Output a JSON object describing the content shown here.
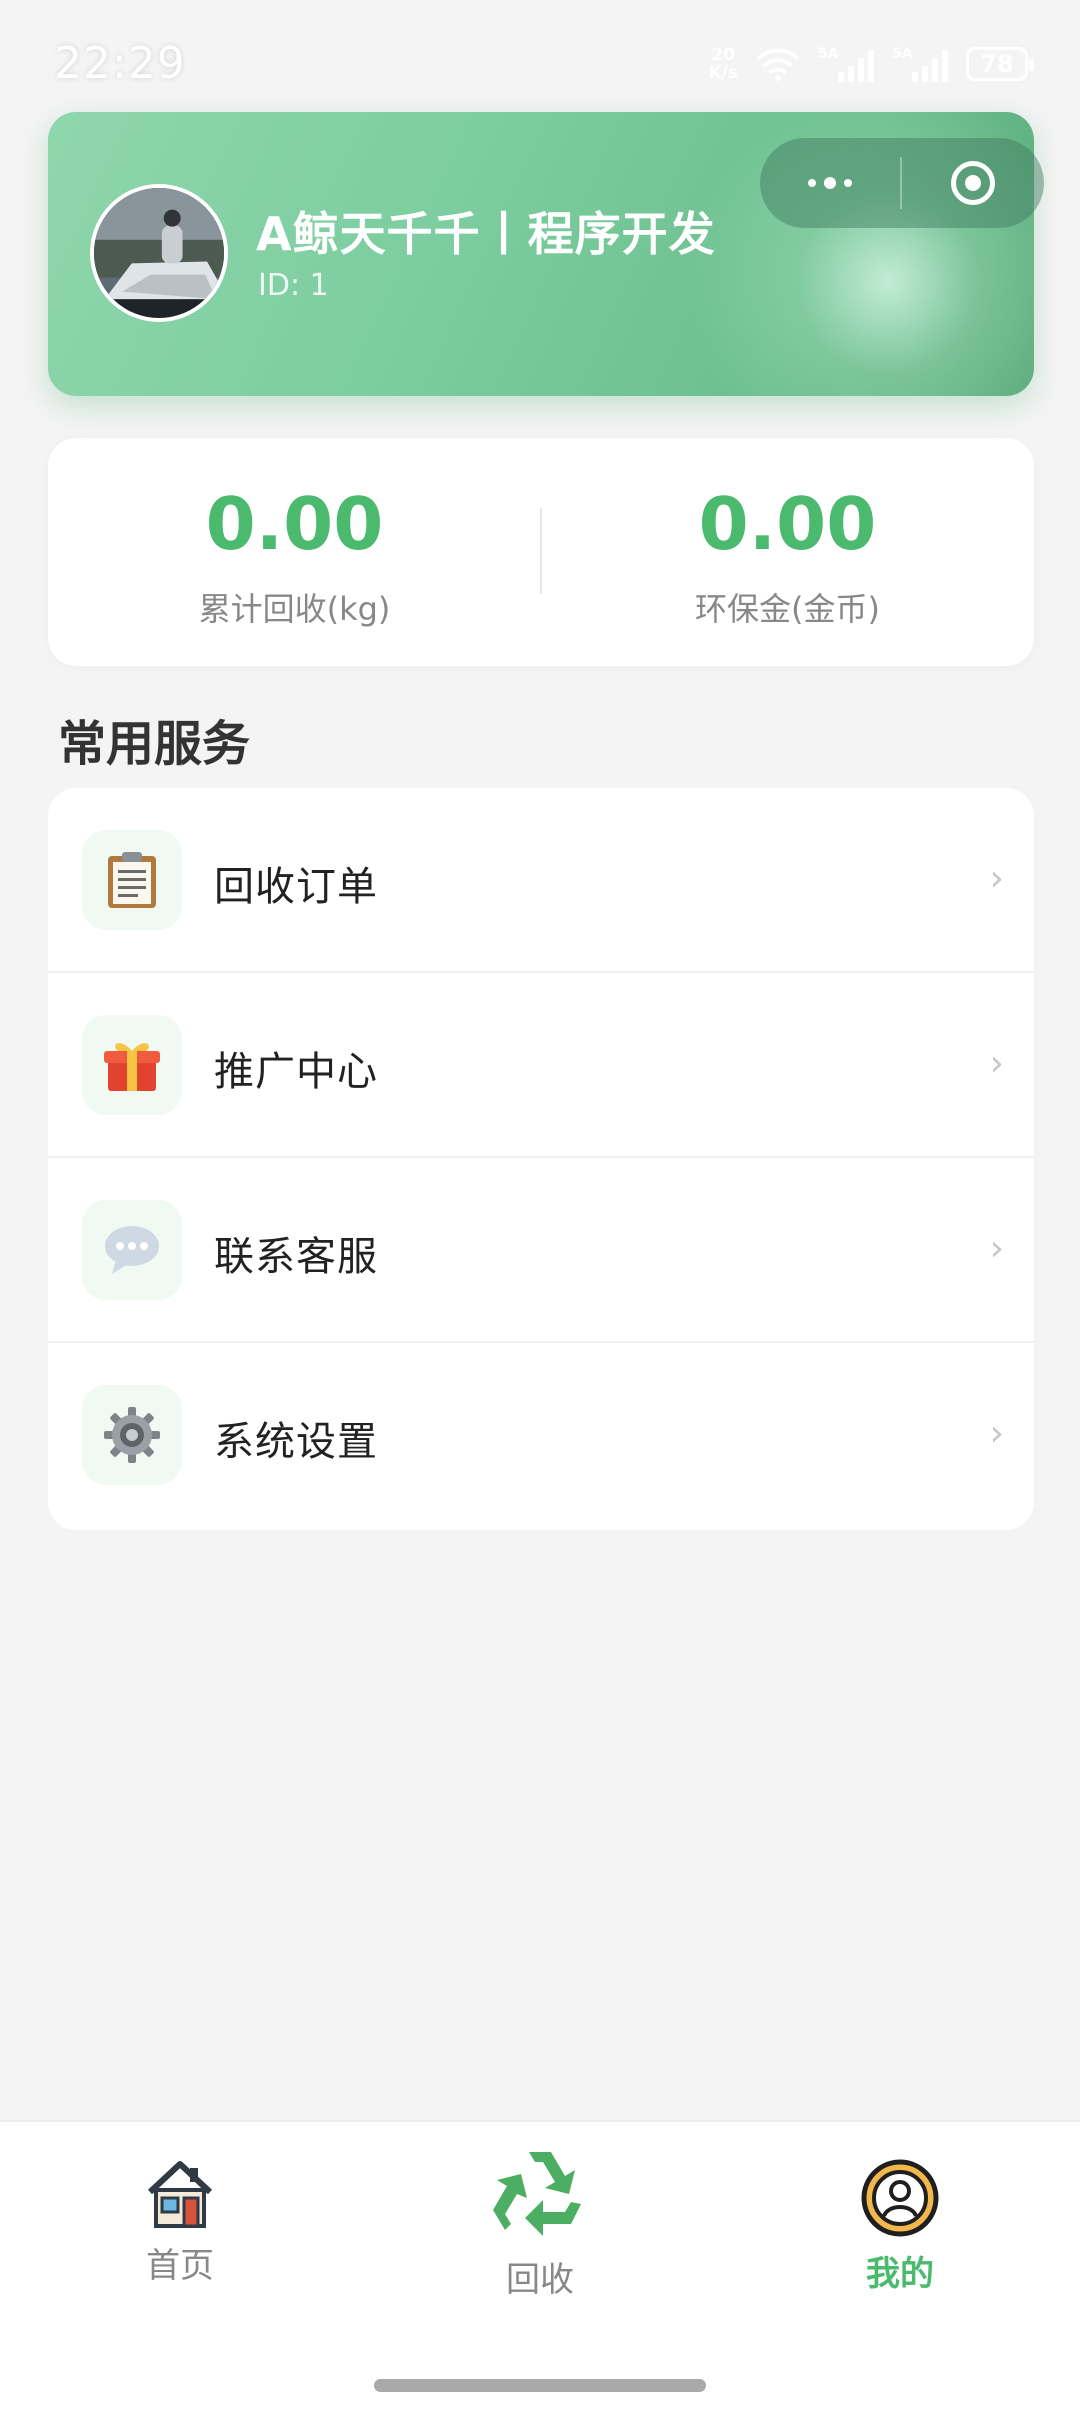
{
  "status_bar": {
    "time": "22:29",
    "net_speed_value": "20",
    "net_speed_unit": "K/s",
    "sim1_label": "5A",
    "sim2_label": "5A",
    "battery": "78"
  },
  "profile": {
    "name": "A鲸天千千丨程序开发",
    "id_text": "ID: 1"
  },
  "stats": {
    "recycled_value": "0.00",
    "recycled_label": "累计回收(kg)",
    "coins_value": "0.00",
    "coins_label": "环保金(金币)"
  },
  "services": {
    "title": "常用服务",
    "items": [
      {
        "label": "回收订单",
        "icon": "clipboard-icon"
      },
      {
        "label": "推广中心",
        "icon": "gift-icon"
      },
      {
        "label": "联系客服",
        "icon": "chat-bubble-icon"
      },
      {
        "label": "系统设置",
        "icon": "gear-icon"
      }
    ],
    "chevron": "›"
  },
  "tabs": [
    {
      "label": "首页",
      "icon": "house-icon",
      "active": false
    },
    {
      "label": "回收",
      "icon": "recycle-icon",
      "active": false
    },
    {
      "label": "我的",
      "icon": "user-circle-icon",
      "active": true
    }
  ],
  "colors": {
    "accent": "#4cba6e",
    "header_gradient_start": "#8fd6ad",
    "header_gradient_end": "#5aa97b",
    "background": "#f4f4f4"
  }
}
